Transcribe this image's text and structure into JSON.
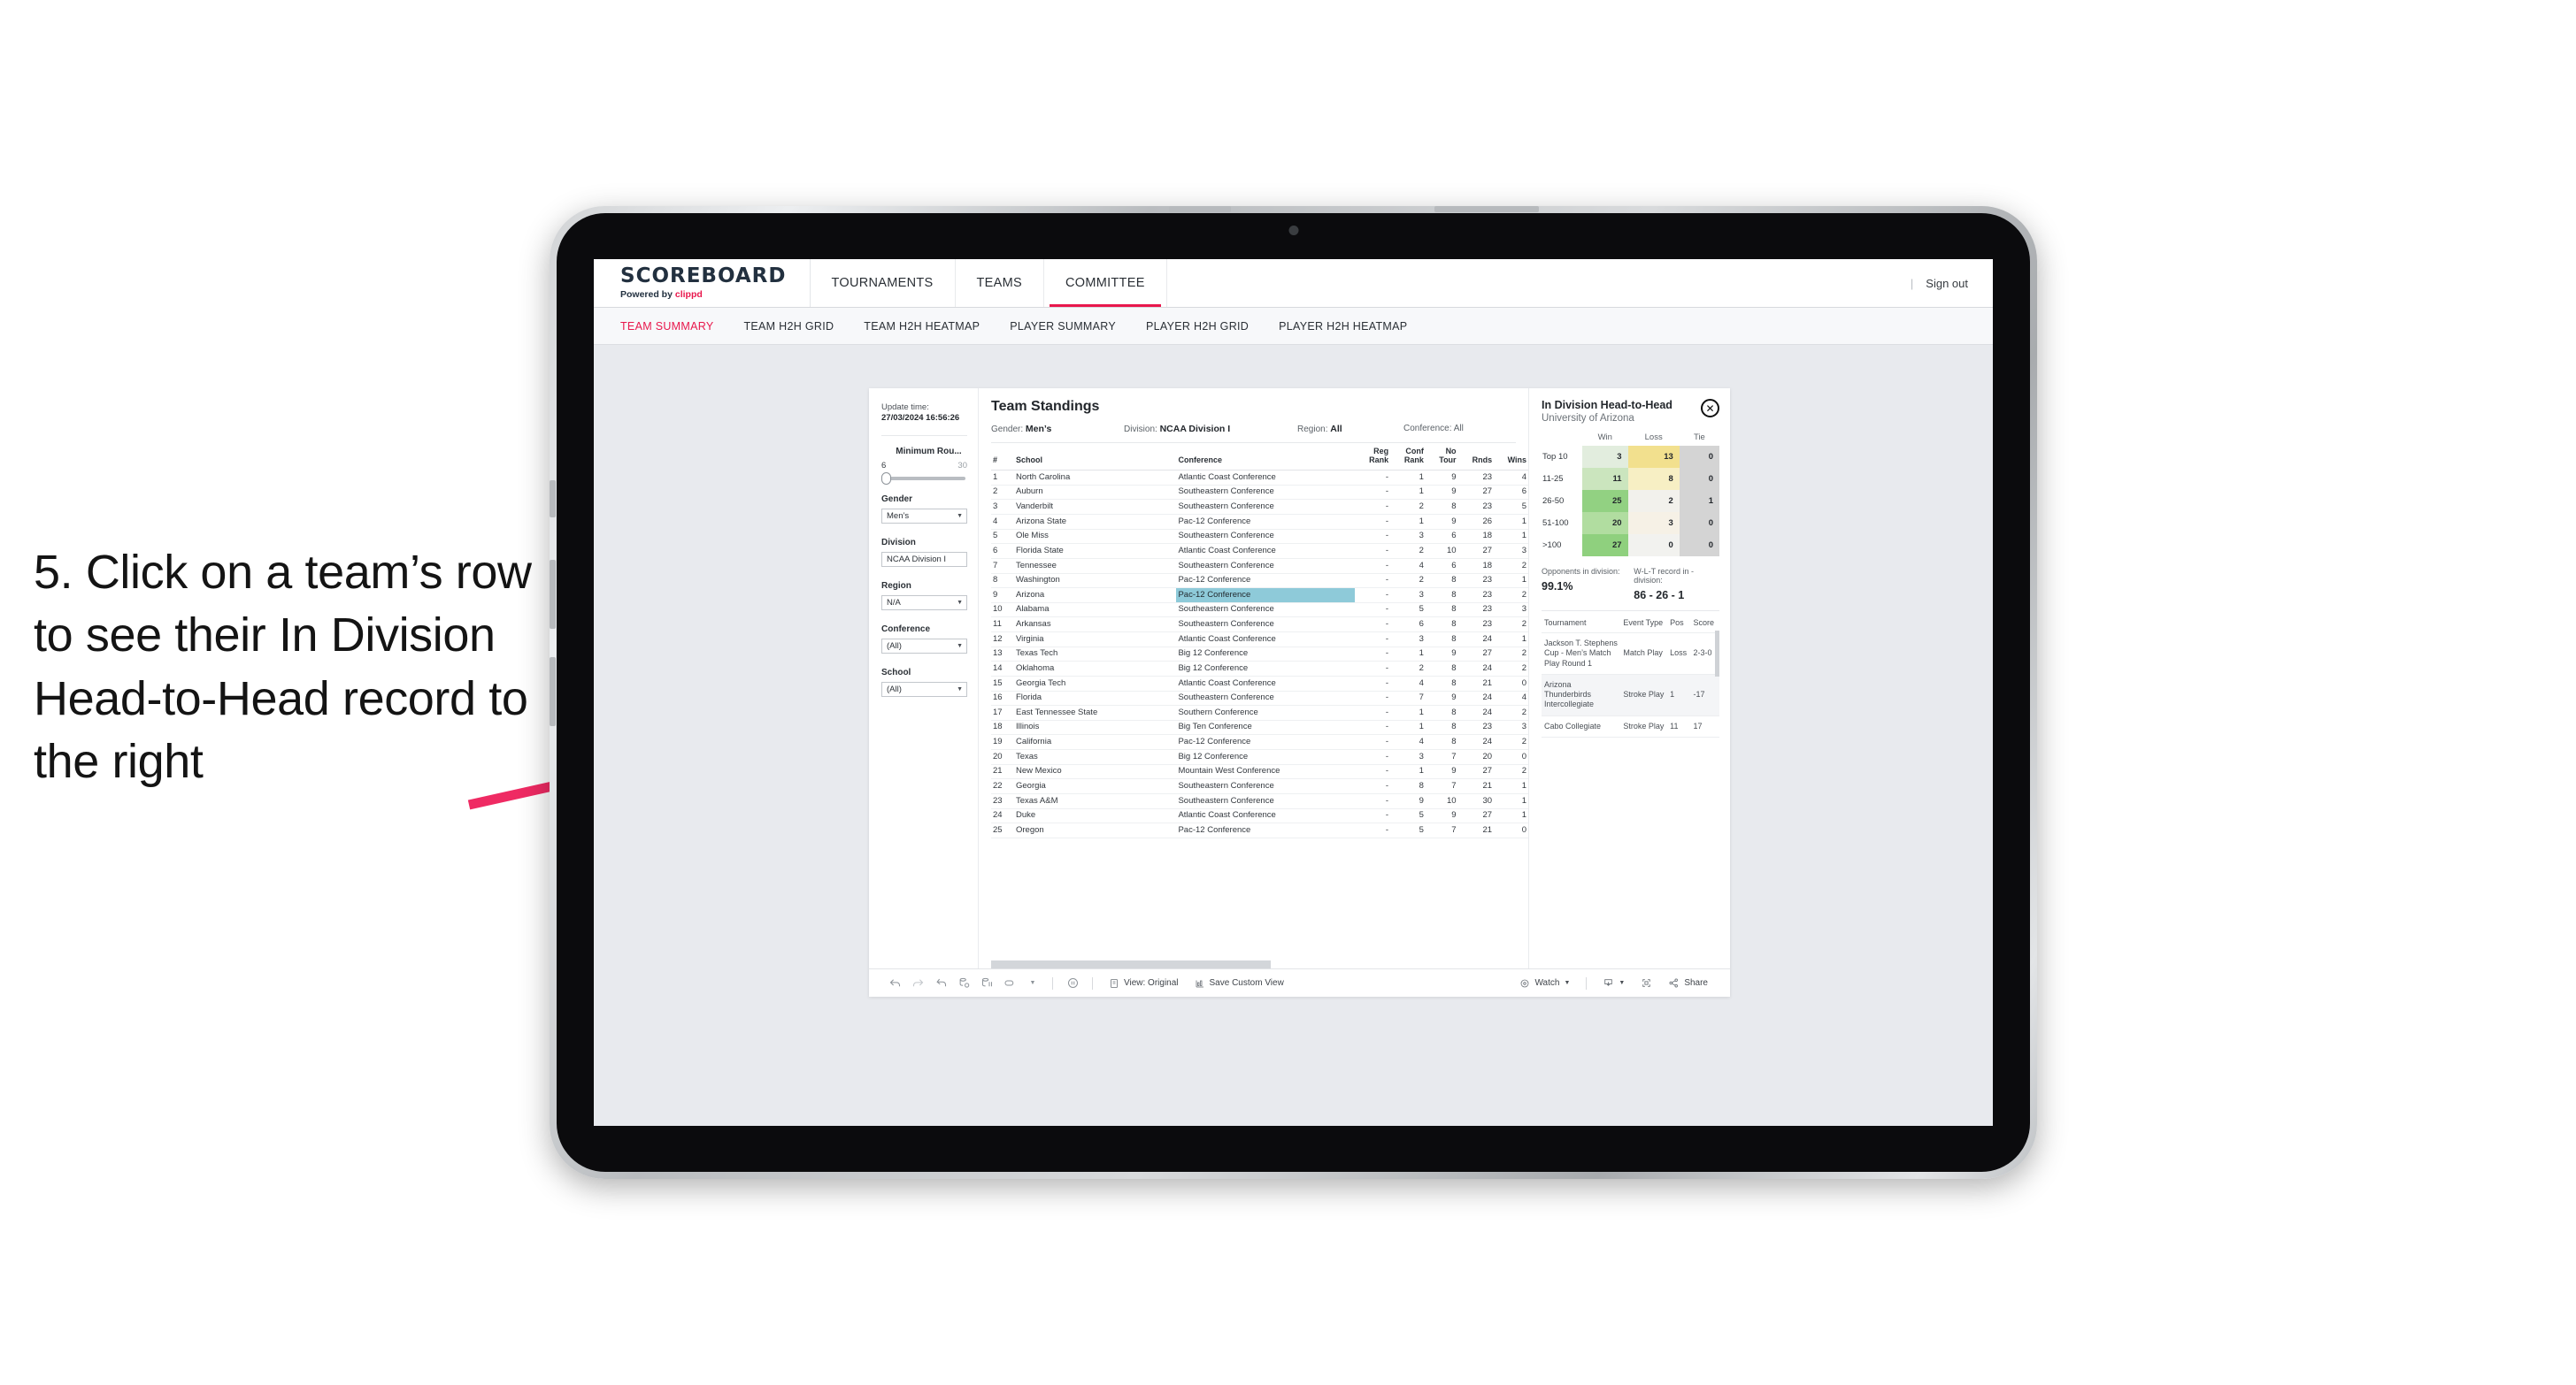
{
  "instruction": {
    "text": "5. Click on a team’s row to see their In Division Head-to-Head record to the right"
  },
  "colors": {
    "accent": "#e8174c",
    "arrow": "#ef2a63",
    "highlight_row": "#8ecad9",
    "screen_bg": "#e8eaee"
  },
  "navbar": {
    "brand_title": "SCOREBOARD",
    "brand_sub_prefix": "Powered by ",
    "brand_sub_name": "clippd",
    "tabs": [
      {
        "label": "TOURNAMENTS",
        "active": false
      },
      {
        "label": "TEAMS",
        "active": false
      },
      {
        "label": "COMMITTEE",
        "active": true
      }
    ],
    "divider": "|",
    "signout_label": "Sign out"
  },
  "subnav": {
    "items": [
      {
        "label": "TEAM SUMMARY",
        "active": true
      },
      {
        "label": "TEAM H2H GRID",
        "active": false
      },
      {
        "label": "TEAM H2H HEATMAP",
        "active": false
      },
      {
        "label": "PLAYER SUMMARY",
        "active": false
      },
      {
        "label": "PLAYER H2H GRID",
        "active": false
      },
      {
        "label": "PLAYER H2H HEATMAP",
        "active": false
      }
    ]
  },
  "filters": {
    "update_time_label": "Update time:",
    "update_time_value": "27/03/2024 16:56:26",
    "slider": {
      "label": "Minimum Rou...",
      "min": "6",
      "max": "30"
    },
    "selects": [
      {
        "label": "Gender",
        "value": "Men’s"
      },
      {
        "label": "Division",
        "value": "NCAA Division I"
      },
      {
        "label": "Region",
        "value": "N/A"
      },
      {
        "label": "Conference",
        "value": "(All)"
      },
      {
        "label": "School",
        "value": "(All)"
      }
    ]
  },
  "standings": {
    "title": "Team Standings",
    "meta": [
      {
        "label": "Gender: ",
        "value": "Men’s"
      },
      {
        "label": "Division: ",
        "value": "NCAA Division I"
      },
      {
        "label": "Region: ",
        "value": "All"
      },
      {
        "label": "Conference: ",
        "value": "All"
      }
    ],
    "columns": [
      "#",
      "School",
      "Conference",
      "Reg Rank",
      "Conf Rank",
      "No Tour",
      "Rnds",
      "Wins"
    ],
    "column_lines": [
      [
        "#"
      ],
      [
        "School"
      ],
      [
        "Conference"
      ],
      [
        "Reg",
        "Rank"
      ],
      [
        "Conf",
        "Rank"
      ],
      [
        "No",
        "Tour"
      ],
      [
        "Rnds"
      ],
      [
        "Wins"
      ]
    ],
    "rows": [
      {
        "rank": "1",
        "school": "North Carolina",
        "conference": "Atlantic Coast Conference",
        "reg_rank": "-",
        "conf_rank": "1",
        "no_tour": "9",
        "rnds": "23",
        "wins": "4",
        "highlight": false
      },
      {
        "rank": "2",
        "school": "Auburn",
        "conference": "Southeastern Conference",
        "reg_rank": "-",
        "conf_rank": "1",
        "no_tour": "9",
        "rnds": "27",
        "wins": "6",
        "highlight": false
      },
      {
        "rank": "3",
        "school": "Vanderbilt",
        "conference": "Southeastern Conference",
        "reg_rank": "-",
        "conf_rank": "2",
        "no_tour": "8",
        "rnds": "23",
        "wins": "5",
        "highlight": false
      },
      {
        "rank": "4",
        "school": "Arizona State",
        "conference": "Pac-12 Conference",
        "reg_rank": "-",
        "conf_rank": "1",
        "no_tour": "9",
        "rnds": "26",
        "wins": "1",
        "highlight": false
      },
      {
        "rank": "5",
        "school": "Ole Miss",
        "conference": "Southeastern Conference",
        "reg_rank": "-",
        "conf_rank": "3",
        "no_tour": "6",
        "rnds": "18",
        "wins": "1",
        "highlight": false
      },
      {
        "rank": "6",
        "school": "Florida State",
        "conference": "Atlantic Coast Conference",
        "reg_rank": "-",
        "conf_rank": "2",
        "no_tour": "10",
        "rnds": "27",
        "wins": "3",
        "highlight": false
      },
      {
        "rank": "7",
        "school": "Tennessee",
        "conference": "Southeastern Conference",
        "reg_rank": "-",
        "conf_rank": "4",
        "no_tour": "6",
        "rnds": "18",
        "wins": "2",
        "highlight": false
      },
      {
        "rank": "8",
        "school": "Washington",
        "conference": "Pac-12 Conference",
        "reg_rank": "-",
        "conf_rank": "2",
        "no_tour": "8",
        "rnds": "23",
        "wins": "1",
        "highlight": false
      },
      {
        "rank": "9",
        "school": "Arizona",
        "conference": "Pac-12 Conference",
        "reg_rank": "-",
        "conf_rank": "3",
        "no_tour": "8",
        "rnds": "23",
        "wins": "2",
        "highlight": true
      },
      {
        "rank": "10",
        "school": "Alabama",
        "conference": "Southeastern Conference",
        "reg_rank": "-",
        "conf_rank": "5",
        "no_tour": "8",
        "rnds": "23",
        "wins": "3",
        "highlight": false
      },
      {
        "rank": "11",
        "school": "Arkansas",
        "conference": "Southeastern Conference",
        "reg_rank": "-",
        "conf_rank": "6",
        "no_tour": "8",
        "rnds": "23",
        "wins": "2",
        "highlight": false
      },
      {
        "rank": "12",
        "school": "Virginia",
        "conference": "Atlantic Coast Conference",
        "reg_rank": "-",
        "conf_rank": "3",
        "no_tour": "8",
        "rnds": "24",
        "wins": "1",
        "highlight": false
      },
      {
        "rank": "13",
        "school": "Texas Tech",
        "conference": "Big 12 Conference",
        "reg_rank": "-",
        "conf_rank": "1",
        "no_tour": "9",
        "rnds": "27",
        "wins": "2",
        "highlight": false
      },
      {
        "rank": "14",
        "school": "Oklahoma",
        "conference": "Big 12 Conference",
        "reg_rank": "-",
        "conf_rank": "2",
        "no_tour": "8",
        "rnds": "24",
        "wins": "2",
        "highlight": false
      },
      {
        "rank": "15",
        "school": "Georgia Tech",
        "conference": "Atlantic Coast Conference",
        "reg_rank": "-",
        "conf_rank": "4",
        "no_tour": "8",
        "rnds": "21",
        "wins": "0",
        "highlight": false
      },
      {
        "rank": "16",
        "school": "Florida",
        "conference": "Southeastern Conference",
        "reg_rank": "-",
        "conf_rank": "7",
        "no_tour": "9",
        "rnds": "24",
        "wins": "4",
        "highlight": false
      },
      {
        "rank": "17",
        "school": "East Tennessee State",
        "conference": "Southern Conference",
        "reg_rank": "-",
        "conf_rank": "1",
        "no_tour": "8",
        "rnds": "24",
        "wins": "2",
        "highlight": false
      },
      {
        "rank": "18",
        "school": "Illinois",
        "conference": "Big Ten Conference",
        "reg_rank": "-",
        "conf_rank": "1",
        "no_tour": "8",
        "rnds": "23",
        "wins": "3",
        "highlight": false
      },
      {
        "rank": "19",
        "school": "California",
        "conference": "Pac-12 Conference",
        "reg_rank": "-",
        "conf_rank": "4",
        "no_tour": "8",
        "rnds": "24",
        "wins": "2",
        "highlight": false
      },
      {
        "rank": "20",
        "school": "Texas",
        "conference": "Big 12 Conference",
        "reg_rank": "-",
        "conf_rank": "3",
        "no_tour": "7",
        "rnds": "20",
        "wins": "0",
        "highlight": false
      },
      {
        "rank": "21",
        "school": "New Mexico",
        "conference": "Mountain West Conference",
        "reg_rank": "-",
        "conf_rank": "1",
        "no_tour": "9",
        "rnds": "27",
        "wins": "2",
        "highlight": false
      },
      {
        "rank": "22",
        "school": "Georgia",
        "conference": "Southeastern Conference",
        "reg_rank": "-",
        "conf_rank": "8",
        "no_tour": "7",
        "rnds": "21",
        "wins": "1",
        "highlight": false
      },
      {
        "rank": "23",
        "school": "Texas A&M",
        "conference": "Southeastern Conference",
        "reg_rank": "-",
        "conf_rank": "9",
        "no_tour": "10",
        "rnds": "30",
        "wins": "1",
        "highlight": false
      },
      {
        "rank": "24",
        "school": "Duke",
        "conference": "Atlantic Coast Conference",
        "reg_rank": "-",
        "conf_rank": "5",
        "no_tour": "9",
        "rnds": "27",
        "wins": "1",
        "highlight": false
      },
      {
        "rank": "25",
        "school": "Oregon",
        "conference": "Pac-12 Conference",
        "reg_rank": "-",
        "conf_rank": "5",
        "no_tour": "7",
        "rnds": "21",
        "wins": "0",
        "highlight": false
      }
    ]
  },
  "h2h": {
    "title": "In Division Head-to-Head",
    "subtitle": "University of Arizona",
    "close_glyph": "✕",
    "columns": [
      "",
      "Win",
      "Loss",
      "Tie"
    ],
    "rows": [
      {
        "band": "Top 10",
        "win": "3",
        "loss": "13",
        "tie": "0",
        "win_color": "#e2edde",
        "loss_color": "#f2e08e",
        "tie_color": "#d4d4d4"
      },
      {
        "band": "11-25",
        "win": "11",
        "loss": "8",
        "tie": "0",
        "win_color": "#cbe5be",
        "loss_color": "#f7efc4",
        "tie_color": "#d4d4d4"
      },
      {
        "band": "26-50",
        "win": "25",
        "loss": "2",
        "tie": "1",
        "win_color": "#92d182",
        "loss_color": "#f2f1ec",
        "tie_color": "#d4d4d4"
      },
      {
        "band": "51-100",
        "win": "20",
        "loss": "3",
        "tie": "0",
        "win_color": "#b1dda0",
        "loss_color": "#f6f1e6",
        "tie_color": "#d4d4d4"
      },
      {
        "band": ">100",
        "win": "27",
        "loss": "0",
        "tie": "0",
        "win_color": "#8fd07e",
        "loss_color": "#f2f2ef",
        "tie_color": "#d4d4d4"
      }
    ],
    "stats": [
      {
        "label": "Opponents in division:",
        "value": "99.1%"
      },
      {
        "label": "W-L-T record in -division:",
        "value": "86 - 26 - 1"
      }
    ],
    "tournaments": {
      "columns": [
        "Tournament",
        "Event Type",
        "Pos",
        "Score"
      ],
      "rows": [
        {
          "name": "Jackson T. Stephens Cup - Men’s Match Play Round 1",
          "event_type": "Match Play",
          "pos": "Loss",
          "score": "2-3-0"
        },
        {
          "name": "Arizona Thunderbirds Intercollegiate",
          "event_type": "Stroke Play",
          "pos": "1",
          "score": "-17"
        },
        {
          "name": "Cabo Collegiate",
          "event_type": "Stroke Play",
          "pos": "11",
          "score": "17"
        }
      ]
    }
  },
  "toolbar": {
    "icons": [
      "undo-icon",
      "redo-icon",
      "revert-icon",
      "refresh-data-icon",
      "pause-updates-icon",
      "bookmark-icon"
    ],
    "view_label": "View: Original",
    "save_label": "Save Custom View",
    "watch_label": "Watch",
    "share_label": "Share"
  }
}
